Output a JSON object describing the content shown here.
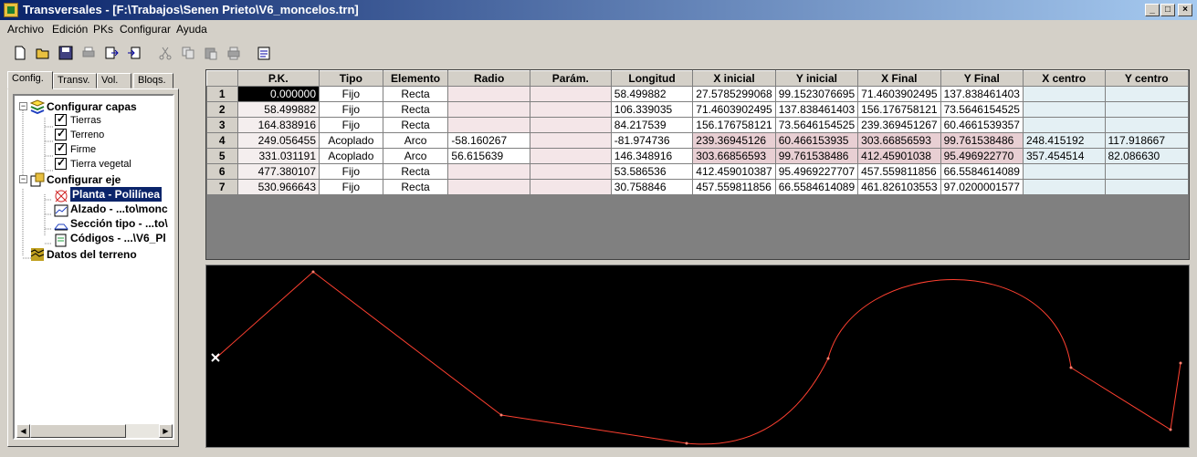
{
  "window": {
    "title": "Transversales - [F:\\Trabajos\\Senen Prieto\\V6_moncelos.trn]"
  },
  "menu": [
    "Archivo",
    "Edición",
    "PKs",
    "Configurar",
    "Ayuda"
  ],
  "toolbar": [
    "new-icon",
    "open-icon",
    "save-icon",
    "print-icon",
    "export-icon",
    "import-icon",
    "cut-icon",
    "copy-icon",
    "paste-icon",
    "print-setup-icon",
    "properties-icon"
  ],
  "tabs": [
    "Config.",
    "Transv.",
    "Vol.",
    "Bloqs."
  ],
  "tree": {
    "capas": "Configurar capas",
    "layers": [
      "Tierras",
      "Terreno",
      "Firme",
      "Tierra vegetal"
    ],
    "eje": "Configurar eje",
    "eje_items": [
      "Planta - Polilínea",
      "Alzado - ...to\\monc",
      "Sección tipo - ...to\\",
      "Códigos - ...\\V6_Pl"
    ],
    "terreno": "Datos del terreno"
  },
  "grid": {
    "headers": [
      "P.K.",
      "Tipo",
      "Elemento",
      "Radio",
      "Parám.",
      "Longitud",
      "X inicial",
      "Y inicial",
      "X Final",
      "Y Final",
      "X centro",
      "Y centro"
    ],
    "rows": [
      {
        "n": "1",
        "pk": "0.000000",
        "tipo": "Fijo",
        "elem": "Recta",
        "radio": "",
        "param": "",
        "long": "58.499882",
        "xi": "27.5785299068",
        "yi": "99.1523076695",
        "xf": "71.4603902495",
        "yf": "137.838461403",
        "xc": "",
        "yc": ""
      },
      {
        "n": "2",
        "pk": "58.499882",
        "tipo": "Fijo",
        "elem": "Recta",
        "radio": "",
        "param": "",
        "long": "106.339035",
        "xi": "71.4603902495",
        "yi": "137.838461403",
        "xf": "156.176758121",
        "yf": "73.5646154525",
        "xc": "",
        "yc": ""
      },
      {
        "n": "3",
        "pk": "164.838916",
        "tipo": "Fijo",
        "elem": "Recta",
        "radio": "",
        "param": "",
        "long": "84.217539",
        "xi": "156.176758121",
        "yi": "73.5646154525",
        "xf": "239.369451267",
        "yf": "60.4661539357",
        "xc": "",
        "yc": ""
      },
      {
        "n": "4",
        "pk": "249.056455",
        "tipo": "Acoplado",
        "elem": "Arco",
        "radio": "-58.160267",
        "param": "",
        "long": "-81.974736",
        "xi": "239.36945126",
        "yi": "60.466153935",
        "xf": "303.66856593",
        "yf": "99.761538486",
        "xc": "248.415192",
        "yc": "117.918667"
      },
      {
        "n": "5",
        "pk": "331.031191",
        "tipo": "Acoplado",
        "elem": "Arco",
        "radio": "56.615639",
        "param": "",
        "long": "146.348916",
        "xi": "303.66856593",
        "yi": "99.761538486",
        "xf": "412.45901038",
        "yf": "95.496922770",
        "xc": "357.454514",
        "yc": "82.086630"
      },
      {
        "n": "6",
        "pk": "477.380107",
        "tipo": "Fijo",
        "elem": "Recta",
        "radio": "",
        "param": "",
        "long": "53.586536",
        "xi": "412.459010387",
        "yi": "95.4969227707",
        "xf": "457.559811856",
        "yf": "66.5584614089",
        "xc": "",
        "yc": ""
      },
      {
        "n": "7",
        "pk": "530.966643",
        "tipo": "Fijo",
        "elem": "Recta",
        "radio": "",
        "param": "",
        "long": "30.758846",
        "xi": "457.559811856",
        "yi": "66.5584614089",
        "xf": "461.826103553",
        "yf": "97.0200001577",
        "xc": "",
        "yc": ""
      }
    ]
  },
  "plan": {
    "background": "#000000",
    "line_color": "#ff4030",
    "cursor_color": "#ffffff"
  }
}
